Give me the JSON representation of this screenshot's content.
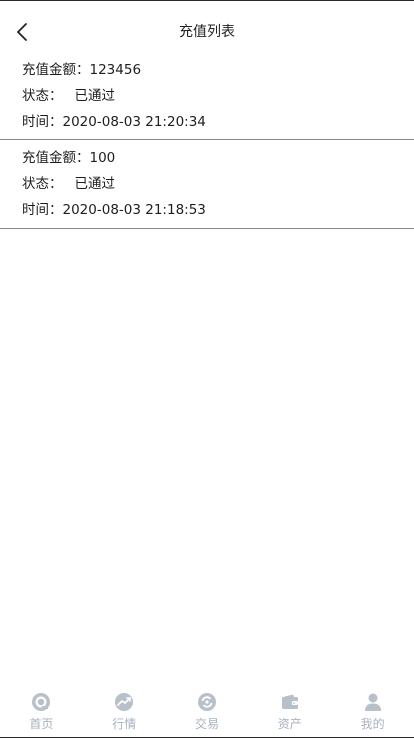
{
  "header": {
    "title": "充值列表",
    "back_icon": "chevron-left-icon"
  },
  "records": [
    {
      "amount_label": "充值金额：",
      "amount": "123456",
      "status_label": "状态：",
      "status": "已通过",
      "time_label": "时间：",
      "time": "2020-08-03 21:20:34"
    },
    {
      "amount_label": "充值金额：",
      "amount": "100",
      "status_label": "状态：",
      "status": "已通过",
      "time_label": "时间：",
      "time": "2020-08-03 21:18:53"
    }
  ],
  "tabbar": {
    "items": [
      {
        "label": "首页",
        "icon": "home-icon"
      },
      {
        "label": "行情",
        "icon": "trend-icon"
      },
      {
        "label": "交易",
        "icon": "exchange-icon"
      },
      {
        "label": "资产",
        "icon": "wallet-icon"
      },
      {
        "label": "我的",
        "icon": "user-icon"
      }
    ],
    "inactive_color": "#aab2bd"
  }
}
